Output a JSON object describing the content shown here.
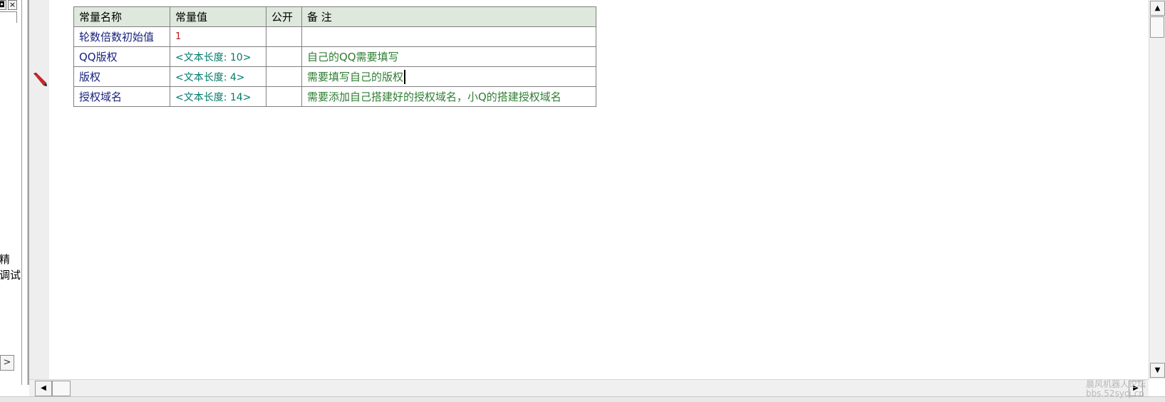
{
  "left_panel": {
    "restore_symbol": "◘",
    "close_symbol": "×",
    "text_line1": "精",
    "text_line2": "调试",
    "arrow_symbol": ">"
  },
  "table": {
    "headers": [
      "常量名称",
      "常量值",
      "公开",
      "备 注"
    ],
    "rows": [
      {
        "name": "轮数倍数初始值",
        "value": "1",
        "public": "",
        "note": ""
      },
      {
        "name": "QQ版权",
        "value": "<文本长度: 10>",
        "public": "",
        "note": "自己的QQ需要填写"
      },
      {
        "name": "版权",
        "value": "<文本长度: 4>",
        "public": "",
        "note": "需要填写自己的版权"
      },
      {
        "name": "授权域名",
        "value": "<文本长度: 14>",
        "public": "",
        "note": "需要添加自己搭建好的授权域名，小Q的搭建授权域名"
      }
    ]
  },
  "scroll": {
    "up": "▲",
    "down": "▼",
    "left": "◀",
    "right": "▶"
  },
  "watermark": {
    "line1": "晨风机器人论坛",
    "line2": "bbs.52sycj.cn"
  },
  "colors": {
    "name_text": "#1a237e",
    "value_number": "#b71c1c",
    "value_length": "#00796b",
    "note_text": "#2e7d32",
    "header_bg": "#dfe8dc"
  }
}
